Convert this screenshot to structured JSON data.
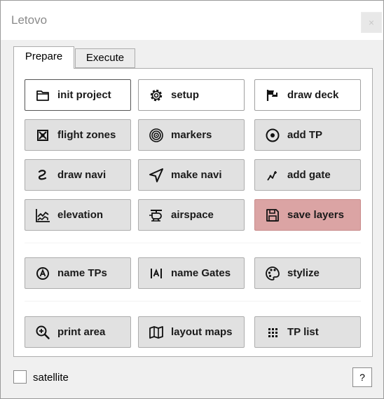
{
  "window": {
    "title": "Letovo",
    "close_glyph": "×"
  },
  "tabs": [
    {
      "label": "Prepare",
      "active": true
    },
    {
      "label": "Execute",
      "active": false
    }
  ],
  "buttons": [
    {
      "label": "init project",
      "icon": "folder-icon"
    },
    {
      "label": "setup",
      "icon": "gear-icon"
    },
    {
      "label": "draw deck",
      "icon": "flag-icon"
    },
    {
      "label": "flight zones",
      "icon": "crossed-box-icon"
    },
    {
      "label": "markers",
      "icon": "target-icon"
    },
    {
      "label": "add TP",
      "icon": "dot-circle-icon"
    },
    {
      "label": "draw navi",
      "icon": "curve-icon"
    },
    {
      "label": "make navi",
      "icon": "navigation-arrow-icon"
    },
    {
      "label": "add gate",
      "icon": "gate-icon"
    },
    {
      "label": "elevation",
      "icon": "elevation-chart-icon"
    },
    {
      "label": "airspace",
      "icon": "helicopter-icon"
    },
    {
      "label": "save layers",
      "icon": "save-disk-icon"
    },
    {
      "label": "name TPs",
      "icon": "circle-a-icon"
    },
    {
      "label": "name Gates",
      "icon": "bracket-a-icon"
    },
    {
      "label": "stylize",
      "icon": "palette-icon"
    },
    {
      "label": "print area",
      "icon": "zoom-icon"
    },
    {
      "label": "layout maps",
      "icon": "map-icon"
    },
    {
      "label": "TP list",
      "icon": "grid-dots-icon"
    }
  ],
  "footer": {
    "checkbox_label": "satellite",
    "checkbox_checked": false,
    "help_label": "?"
  },
  "colors": {
    "highlight_button": "#dba4a4",
    "button_bg": "#e1e1e1"
  }
}
